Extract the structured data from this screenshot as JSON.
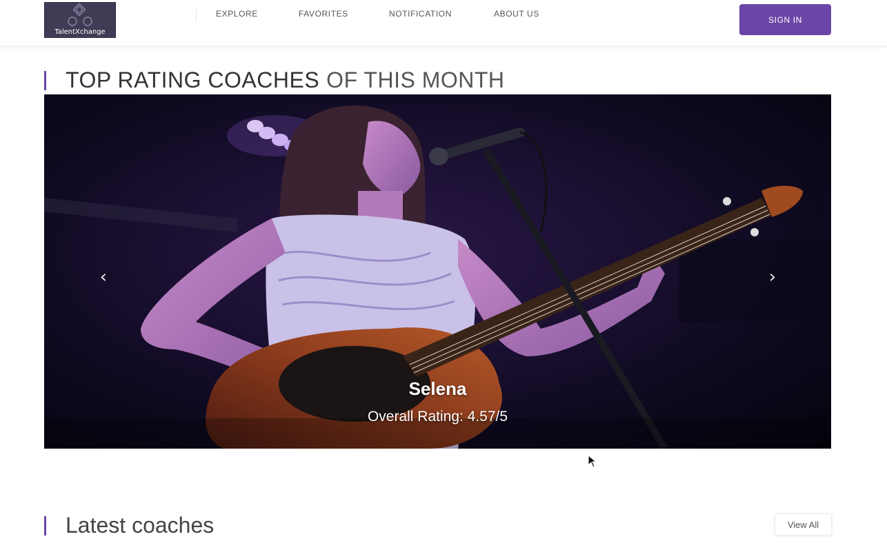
{
  "header": {
    "logo_text": "TalentXchange",
    "nav": [
      {
        "label": "EXPLORE"
      },
      {
        "label": "FAVORITES"
      },
      {
        "label": "NOTIFICATION"
      },
      {
        "label": "ABOUT US"
      }
    ],
    "signin_label": "SIGN IN"
  },
  "top_section": {
    "title_bold": "TOP RATING COACHES",
    "title_light": "OF THIS MONTH"
  },
  "carousel": {
    "prev_icon": "chevron-left-icon",
    "next_icon": "chevron-right-icon",
    "slide": {
      "name": "Selena",
      "rating_text": "Overall Rating: 4.57/5"
    }
  },
  "latest_section": {
    "title": "Latest coaches",
    "view_all_label": "View All"
  },
  "colors": {
    "accent": "#6b46a6",
    "logo_bg": "#3f3d55"
  }
}
